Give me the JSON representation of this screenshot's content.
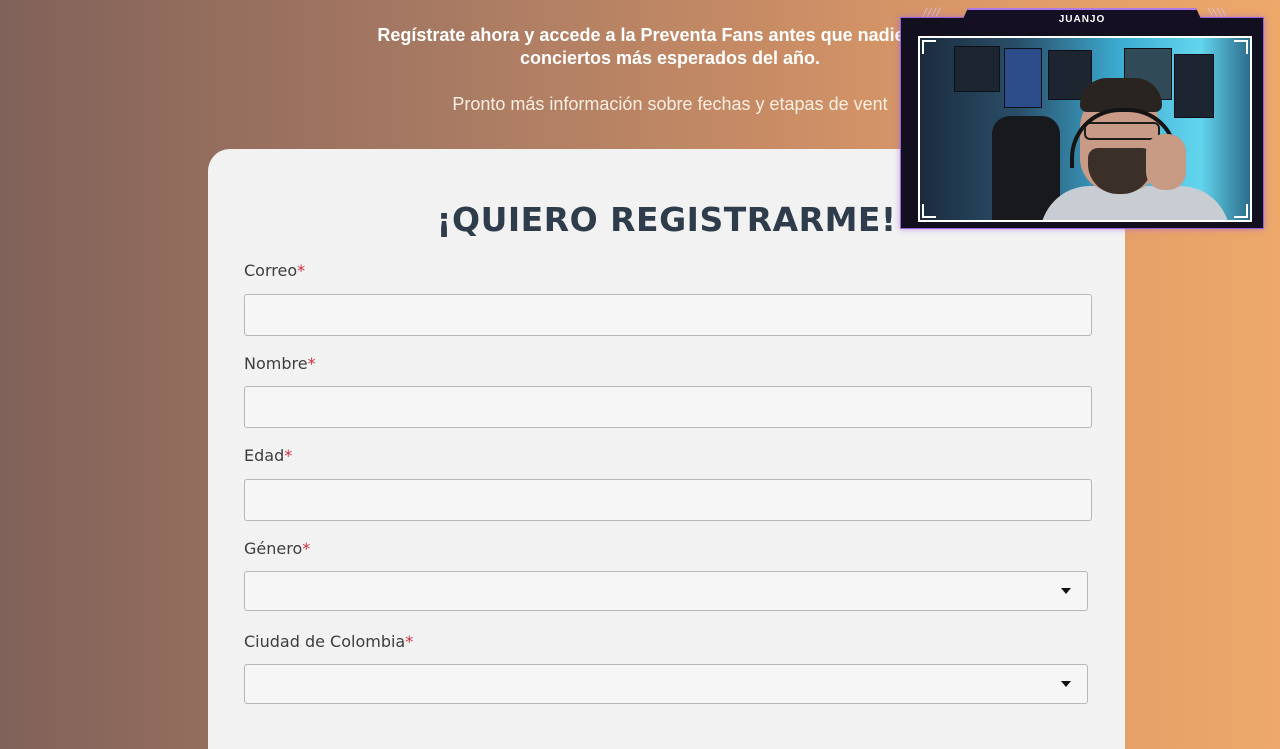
{
  "intro": {
    "bold_line1": "Regístrate ahora y accede a la Preventa Fans antes que nadie. Sé pa",
    "bold_line2": "conciertos más esperados del año.",
    "light_line": "Pronto más información sobre fechas y etapas de vent"
  },
  "form": {
    "title": "¡QUIERO REGISTRARME!",
    "required_mark": "*",
    "fields": [
      {
        "label": "Correo",
        "type": "text",
        "value": ""
      },
      {
        "label": "Nombre",
        "type": "text",
        "value": ""
      },
      {
        "label": "Edad",
        "type": "text",
        "value": ""
      },
      {
        "label": "Género",
        "type": "select",
        "value": ""
      },
      {
        "label": "Ciudad de Colombia",
        "type": "select",
        "value": ""
      }
    ]
  },
  "overlay": {
    "streamer_name": "JUANJO",
    "accent_color": "#9a64d6"
  },
  "colors": {
    "required": "#d22a3c",
    "title": "#2f3c4c"
  }
}
